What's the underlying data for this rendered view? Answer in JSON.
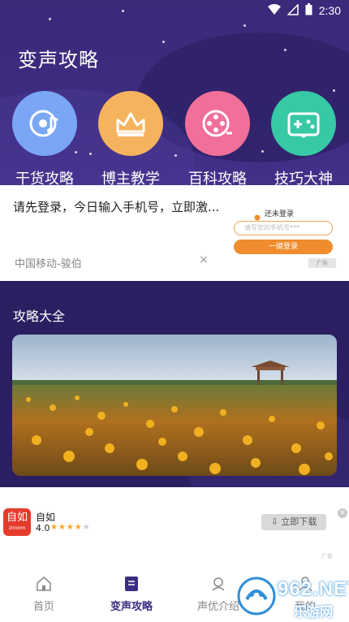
{
  "status_bar": {
    "time": "2:30"
  },
  "page_title": "变声攻略",
  "categories": [
    {
      "label": "干货攻略",
      "icon": "music-disc-icon",
      "color": "#7aa6f5"
    },
    {
      "label": "博主教学",
      "icon": "crown-icon",
      "color": "#f6b35e"
    },
    {
      "label": "百科攻略",
      "icon": "film-reel-icon",
      "color": "#f17099"
    },
    {
      "label": "技巧大神",
      "icon": "gamepad-icon",
      "color": "#37c9a6"
    }
  ],
  "ad_banner": {
    "headline": "请先登录，今日输入手机号，立即激...",
    "source": "中国移动-骏伯",
    "close": "×",
    "mini_title": "还未登录",
    "mini_placeholder": "请写您的手机号***",
    "mini_button": "一键登录",
    "ad_tag": "广告"
  },
  "guide": {
    "title": "攻略大全"
  },
  "app_ad": {
    "icon_text": "自如",
    "icon_sub": "ziroom",
    "name": "自如",
    "rating": "4.0",
    "stars": "★★★★★",
    "download_label": "⇩ 立即下载",
    "close": "×",
    "ad_tag": "广告"
  },
  "tabbar": [
    {
      "label": "首页",
      "icon": "home-icon",
      "active": false
    },
    {
      "label": "变声攻略",
      "icon": "book-icon",
      "active": true
    },
    {
      "label": "声优介绍",
      "icon": "voice-actor-icon",
      "active": false
    },
    {
      "label": "我的",
      "icon": "profile-icon",
      "active": false
    }
  ],
  "watermark": {
    "text": "962.NET",
    "sub": "乐游网"
  },
  "colors": {
    "primary": "#3c2d82",
    "accent_orange": "#f08c2e"
  }
}
